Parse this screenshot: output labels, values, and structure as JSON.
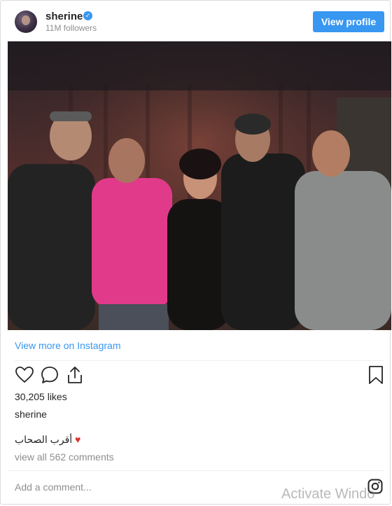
{
  "header": {
    "username": "sherine",
    "followers": "11M followers",
    "view_profile_label": "View profile"
  },
  "post": {
    "image_alt": "Photo of five people posing together in a studio",
    "view_more_label": "View more on Instagram",
    "likes": "30,205 likes",
    "owner": "sherine",
    "caption": "أقرب الصحاب",
    "caption_emoji": "♥",
    "view_comments": "view all 562 comments",
    "add_comment_placeholder": "Add a comment..."
  },
  "icons": {
    "like": "heart-icon",
    "comment": "comment-icon",
    "share": "share-icon",
    "save": "bookmark-icon",
    "instagram": "instagram-icon",
    "verified": "verified-badge-icon"
  },
  "colors": {
    "accent": "#3897f0",
    "text": "#262626",
    "muted": "#8e8e8e",
    "heart": "#e0302a"
  },
  "overlay": {
    "watermark": "Activate Windo"
  }
}
